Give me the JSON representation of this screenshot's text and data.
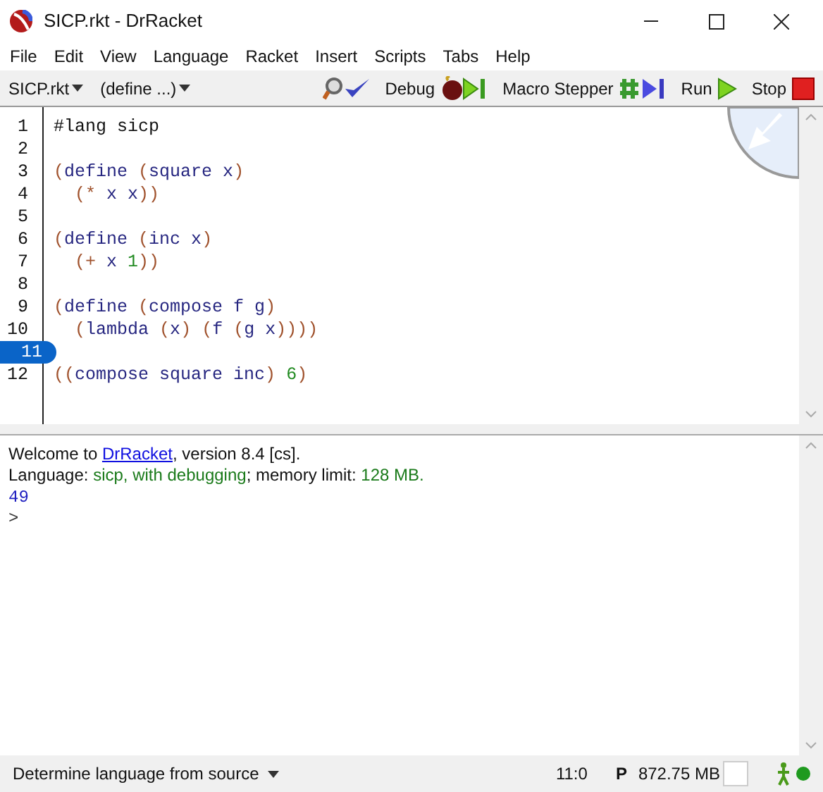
{
  "window": {
    "title": "SICP.rkt - DrRacket"
  },
  "menu": [
    "File",
    "Edit",
    "View",
    "Language",
    "Racket",
    "Insert",
    "Scripts",
    "Tabs",
    "Help"
  ],
  "toolbar": {
    "file_menu": "SICP.rkt",
    "define_menu": "(define ...)",
    "buttons": [
      {
        "kind": "check"
      },
      {
        "kind": "debug",
        "label": "Debug"
      },
      {
        "kind": "stepper",
        "label": "Macro Stepper"
      },
      {
        "kind": "run",
        "label": "Run"
      },
      {
        "kind": "stop",
        "label": "Stop"
      }
    ]
  },
  "editor": {
    "lines": [
      {
        "number": "1",
        "selected": false,
        "tokens": [
          {
            "kind": "plain",
            "text": "#lang sicp"
          }
        ]
      },
      {
        "number": "2",
        "selected": false
      },
      {
        "number": "3",
        "selected": false,
        "tokens": [
          {
            "kind": "paren",
            "text": "("
          },
          {
            "kind": "symbol",
            "text": "define "
          },
          {
            "kind": "paren",
            "text": "("
          },
          {
            "kind": "symbol",
            "text": "square x"
          },
          {
            "kind": "paren",
            "text": ")"
          }
        ]
      },
      {
        "number": "4",
        "selected": false,
        "indented": true,
        "tokens": [
          {
            "kind": "paren",
            "text": "(*"
          },
          {
            "kind": "symbol",
            "text": " x x"
          },
          {
            "kind": "paren",
            "text": "))"
          }
        ]
      },
      {
        "number": "5",
        "selected": false
      },
      {
        "number": "6",
        "selected": false,
        "tokens": [
          {
            "kind": "paren",
            "text": "("
          },
          {
            "kind": "symbol",
            "text": "define "
          },
          {
            "kind": "paren",
            "text": "("
          },
          {
            "kind": "symbol",
            "text": "inc x"
          },
          {
            "kind": "paren",
            "text": ")"
          }
        ]
      },
      {
        "number": "7",
        "selected": false,
        "indented": true,
        "tokens": [
          {
            "kind": "paren",
            "text": "(+"
          },
          {
            "kind": "symbol",
            "text": " x "
          },
          {
            "kind": "number",
            "text": "1"
          },
          {
            "kind": "paren",
            "text": "))"
          }
        ]
      },
      {
        "number": "8",
        "selected": false
      },
      {
        "number": "9",
        "selected": false,
        "tokens": [
          {
            "kind": "paren",
            "text": "("
          },
          {
            "kind": "symbol",
            "text": "define "
          },
          {
            "kind": "paren",
            "text": "("
          },
          {
            "kind": "symbol",
            "text": "compose f g"
          },
          {
            "kind": "paren",
            "text": ")"
          }
        ]
      },
      {
        "number": "10",
        "selected": false,
        "indented": true,
        "tokens": [
          {
            "kind": "paren",
            "text": "("
          },
          {
            "kind": "symbol",
            "text": "lambda "
          },
          {
            "kind": "paren",
            "text": "("
          },
          {
            "kind": "symbol",
            "text": "x"
          },
          {
            "kind": "paren",
            "text": ") ("
          },
          {
            "kind": "symbol",
            "text": "f "
          },
          {
            "kind": "paren",
            "text": "("
          },
          {
            "kind": "symbol",
            "text": "g x"
          },
          {
            "kind": "paren",
            "text": "))))"
          }
        ]
      },
      {
        "number": "11",
        "selected": true
      },
      {
        "number": "12",
        "selected": false,
        "tokens": [
          {
            "kind": "paren",
            "text": "(("
          },
          {
            "kind": "symbol",
            "text": "compose square inc"
          },
          {
            "kind": "paren",
            "text": ") "
          },
          {
            "kind": "number",
            "text": "6"
          },
          {
            "kind": "paren",
            "text": ")"
          }
        ]
      }
    ]
  },
  "interactions": {
    "lines": [
      {
        "kind": "text",
        "segments": [
          {
            "kind": "plain",
            "text": "Welcome to "
          },
          {
            "kind": "link",
            "text": "DrRacket"
          },
          {
            "kind": "plain",
            "text": ", version 8.4 [cs]."
          }
        ]
      },
      {
        "kind": "text",
        "segments": [
          {
            "kind": "plain",
            "text": "Language: "
          },
          {
            "kind": "green",
            "text": "sicp, with debugging"
          },
          {
            "kind": "plain",
            "text": "; memory limit: "
          },
          {
            "kind": "green",
            "text": "128 MB."
          }
        ]
      },
      {
        "kind": "result",
        "segments": [
          {
            "kind": "plain",
            "text": "49"
          }
        ]
      },
      {
        "kind": "prompt",
        "segments": [
          {
            "kind": "plain",
            "text": ">"
          }
        ]
      }
    ]
  },
  "status_bar": {
    "language": "Determine language from source",
    "position": "11:0",
    "mode": "P",
    "memory": "872.75 MB"
  }
}
